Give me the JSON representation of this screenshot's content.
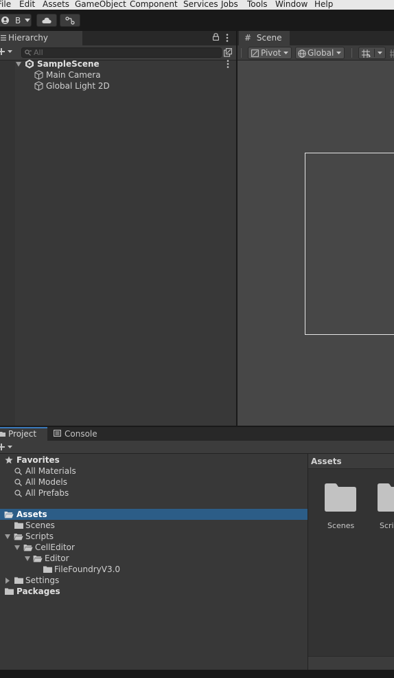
{
  "menu": [
    "File",
    "Edit",
    "Assets",
    "GameObject",
    "Component",
    "Services",
    "Jobs",
    "Tools",
    "Window",
    "Help"
  ],
  "toolbar": {
    "account_label": "B"
  },
  "hierarchy": {
    "tab_label": "Hierarchy",
    "search_placeholder": "All",
    "scene_name": "SampleScene",
    "objects": [
      "Main Camera",
      "Global Light 2D"
    ]
  },
  "scene": {
    "tab_label": "Scene",
    "pivot_label": "Pivot",
    "global_label": "Global"
  },
  "bottom_tabs": {
    "project": "Project",
    "console": "Console"
  },
  "project_tree": {
    "favorites": {
      "label": "Favorites",
      "items": [
        "All Materials",
        "All Models",
        "All Prefabs"
      ]
    },
    "assets": "Assets",
    "scenes": "Scenes",
    "scripts": "Scripts",
    "cell_editor": "CellEditor",
    "editor": "Editor",
    "file_foundry": "FileFoundryV3.0",
    "settings": "Settings",
    "packages": "Packages"
  },
  "assets_pane": {
    "header": "Assets",
    "items": [
      "Scenes",
      "Scrip"
    ]
  }
}
